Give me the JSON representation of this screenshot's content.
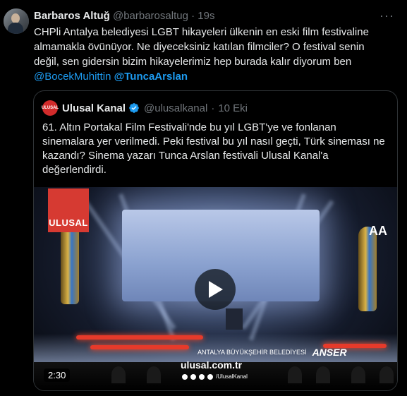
{
  "tweet": {
    "author_name": "Barbaros Altuğ",
    "author_handle": "@barbarosaltug",
    "separator": "·",
    "time": "19s",
    "more_label": "···",
    "text_line": "CHPli Antalya belediyesi LGBT hikayeleri ülkenin en eski film festivaline almamakla övünüyor. Ne diyeceksiniz katılan filmciler? O festival senin değil, sen gidersin bizim hikayelerimiz hep burada kalır diyorum ben",
    "mention_1": "@BocekMuhittin",
    "mention_2": "@TuncaArslan"
  },
  "quote": {
    "avatar_text": "ULUSAL",
    "author_name": "Ulusal Kanal",
    "author_handle": "@ulusalkanal",
    "separator": "·",
    "date": "10 Eki",
    "text": "61. Altın Portakal Film Festivali'nde bu yıl LGBT'ye ve fonlanan sinemalara yer verilmedi. Peki festival bu yıl nasıl geçti, Türk sineması ne kazandı? Sinema yazarı Tunca Arslan festivali Ulusal Kanal'a değerlendirdi."
  },
  "video": {
    "logo_text": "ULUSAL",
    "aa_text": "AA",
    "sponsor_1": "ANTALYA BÜYÜKŞEHİR BELEDİYESİ",
    "sponsor_2": "ANSER",
    "site": "ulusal.com.tr",
    "social_handle": "/UlusalKanal",
    "duration": "2:30",
    "colors": {
      "play_bg": "#0f1419",
      "accent_red": "#e63a2a"
    }
  },
  "icons": [
    "verified-badge-icon",
    "play-icon",
    "more-icon"
  ]
}
